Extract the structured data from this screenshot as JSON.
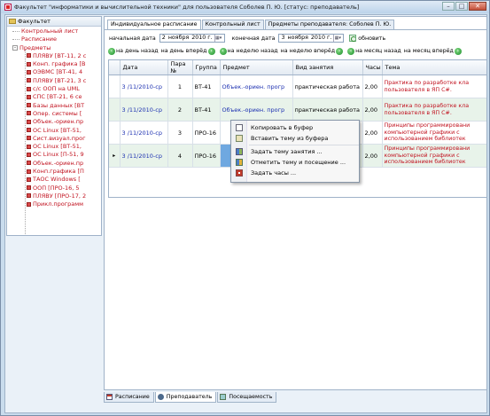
{
  "window": {
    "title": "Факультет \"информатики и вычислительной техники\" для пользователя Соболев П. Ю. [статус: преподаватель]",
    "controls": {
      "minimize": "–",
      "maximize": "□",
      "close": "✕"
    }
  },
  "sidebar": {
    "root_label": "Факультет",
    "items": [
      {
        "label": "Контрольный лист",
        "expander": ""
      },
      {
        "label": "Расписание",
        "expander": ""
      },
      {
        "label": "Предметы",
        "expander": "–"
      }
    ],
    "subjects": [
      "ПЛЯВУ [ВТ-11, 2 с",
      "Конп. графика [В",
      "ОЭВМС [ВТ-41, 4",
      "ПЛЯВУ [ВТ-21, 3 с",
      "с/с ООП на UML",
      "СПС [ВТ-21, 6 се",
      "Базы данных [ВТ",
      "Опер. системы [",
      "Объек.-ориен.пр",
      "ОС Linux [ВТ-51,",
      "Сист.визуал.прог",
      "ОС Linux [ВТ-51,",
      "ОС Linux [П-51, 9",
      "Объек.-ориен.пр",
      "Конп.графика [П",
      "ТАОС Windows [",
      "ООП [ПРО-16, 5",
      "ПЛЯВУ [ПРО-17, 2",
      "Прикл.программ"
    ]
  },
  "tabs": [
    {
      "label": "Индивидуальное расписание",
      "active": true
    },
    {
      "label": "Контрольный лист",
      "active": false
    },
    {
      "label": "Предметы преподавателя: Соболев П. Ю.",
      "active": false
    }
  ],
  "toolbar": {
    "start_label": "начальная дата",
    "start_day": "2",
    "start_month": "ноября",
    "start_year": "2010 г.",
    "end_label": "конечная дата",
    "end_day": "3",
    "end_month": "ноября",
    "end_year": "2010 г.",
    "refresh_label": "обновить"
  },
  "navigation": {
    "day_back": "на день назад",
    "day_forward": "на день вперёд",
    "week_back": "на неделю назад",
    "week_forward": "на неделю вперёд",
    "month_back": "на месяц назад",
    "month_forward": "на месяц вперёд"
  },
  "table": {
    "columns": [
      "Дата",
      "Пара №",
      "Группа",
      "Предмет",
      "Вид занятия",
      "Часы",
      "Тема"
    ],
    "rows": [
      {
        "marker": "",
        "date": "3 /11/2010-ср",
        "pair": "1",
        "group": "ВТ-41",
        "subject": "Объек.-ориен. прогр",
        "type": "практическая работа",
        "hours": "2,00",
        "theme": "Практика по разработке кла пользователя в ЯП C#."
      },
      {
        "marker": "",
        "date": "3 /11/2010-ср",
        "pair": "2",
        "group": "ВТ-41",
        "subject": "Объек.-ориен. прогр",
        "type": "практическая работа",
        "hours": "2,00",
        "theme": "Практика по разработке кла пользователя в ЯП C#."
      },
      {
        "marker": "",
        "date": "3 /11/2010-ср",
        "pair": "3",
        "group": "ПРО-16",
        "subject": "",
        "type": "",
        "hours": "2,00",
        "theme": "Принципы программировани компьютерной графики с использованием библиотек"
      },
      {
        "marker": "▸",
        "date": "3 /11/2010-ср",
        "pair": "4",
        "group": "ПРО-16",
        "subject": "",
        "type": "",
        "hours": "2,00",
        "theme": "Принципы программировани компьютерной графики с использованием библиотек"
      }
    ]
  },
  "context_menu": {
    "items": [
      {
        "label": "Копировать в буфер",
        "icon": "copy-icon"
      },
      {
        "label": "Вставить тему из буфера",
        "icon": "paste-icon"
      },
      {
        "label": "Задать тему занятия ...",
        "icon": "book-icon"
      },
      {
        "label": "Отметить тему и посещение ...",
        "icon": "check-icon"
      },
      {
        "label": "Задать часы ...",
        "icon": "clock-icon"
      }
    ]
  },
  "bottom_tabs": [
    {
      "label": "Расписание",
      "active": false
    },
    {
      "label": "Преподаватель",
      "active": true
    },
    {
      "label": "Посещаемость",
      "active": false
    }
  ]
}
